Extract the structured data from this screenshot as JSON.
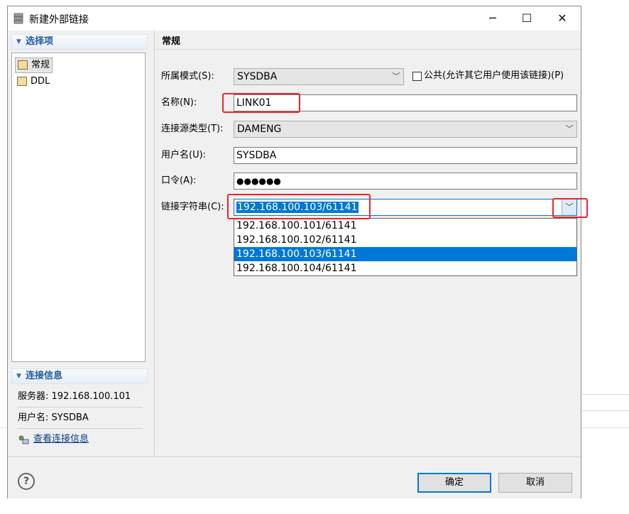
{
  "window": {
    "title": "新建外部链接",
    "minimize": "─",
    "maximize": "☐",
    "close": "✕"
  },
  "left": {
    "options_header": "选择项",
    "tree": [
      {
        "label": "常规",
        "icon": "properties-icon"
      },
      {
        "label": "DDL",
        "icon": "ddl-icon"
      }
    ],
    "conn_header": "连接信息",
    "server": "服务器: 192.168.100.101",
    "user": "用户名: SYSDBA",
    "view_link": "查看连接信息"
  },
  "form": {
    "title": "常规",
    "schema_label": "所属模式(S):",
    "schema_value": "SYSDBA",
    "public_label": "公共(允许其它用户使用该链接)(P)",
    "name_label": "名称(N):",
    "name_value": "LINK01",
    "source_label": "连接源类型(T):",
    "source_value": "DAMENG",
    "user_label": "用户名(U):",
    "user_value": "SYSDBA",
    "password_label": "口令(A):",
    "password_value": "●●●●●●",
    "conn_label": "链接字符串(C):",
    "conn_value": "192.168.100.103/61141",
    "conn_options": [
      "192.168.100.101/61141",
      "192.168.100.102/61141",
      "192.168.100.103/61141",
      "192.168.100.104/61141"
    ],
    "selected_option_index": 2,
    "highlight_color": "#0078d7",
    "annotation_color": "#e8262d"
  },
  "buttons": {
    "help": "?",
    "ok": "确定",
    "cancel": "取消"
  }
}
